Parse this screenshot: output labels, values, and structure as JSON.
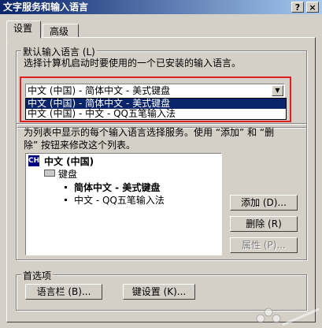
{
  "window": {
    "title": "文字服务和输入语言",
    "help_label": "?",
    "close_label": "×"
  },
  "tabs": [
    {
      "label": "设置",
      "active": true
    },
    {
      "label": "高级",
      "active": false
    }
  ],
  "default_lang": {
    "group_label": "默认输入语言 (L)",
    "description": "选择计算机启动时要使用的一个已安装的输入语言。",
    "combo_value": "中文 (中国) - 简体中文 - 美式键盘",
    "dropdown_options": [
      {
        "label": "中文 (中国) - 简体中文 - 美式键盘",
        "selected": true
      },
      {
        "label": "中文 (中国) - 中文 - QQ五笔输入法",
        "selected": false
      }
    ]
  },
  "installed": {
    "description_line1": "为列表中显示的每个输入语言选择服务。使用 “添加” 和 “删",
    "description_line2": "除” 按钮来修改这个列表。",
    "tree": {
      "language_code": "CH",
      "language": "中文 (中国)",
      "category": "键盘",
      "items": [
        {
          "label": "简体中文 - 美式键盘",
          "bold": true
        },
        {
          "label": "中文 - QQ五笔输入法",
          "bold": false
        }
      ]
    },
    "add_label": "添加 (D)...",
    "remove_label": "删除 (R)",
    "properties_label": "属性 (P)..."
  },
  "preferences": {
    "group_label": "首选项",
    "language_bar_label": "语言栏 (B)...",
    "key_settings_label": "键设置 (K)..."
  },
  "colors": {
    "title_start": "#0a246a",
    "title_end": "#a6caf0",
    "face": "#d4d0c8",
    "selection": "#0a246a",
    "highlight_box": "#e02020"
  }
}
